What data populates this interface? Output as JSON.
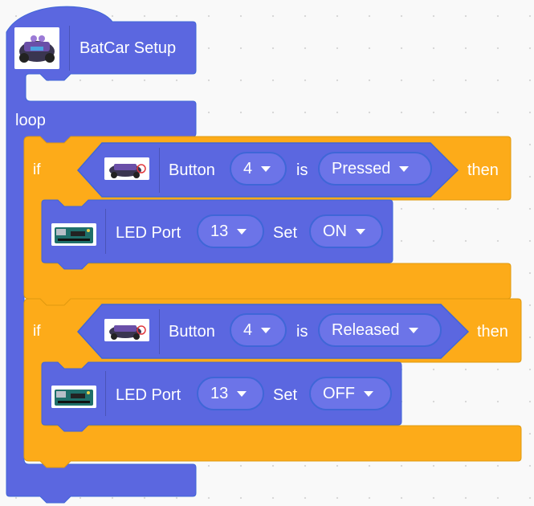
{
  "setup_block": {
    "label": "BatCar Setup",
    "icon": "batcar-robot-icon"
  },
  "loop_block": {
    "label": "loop"
  },
  "if_blocks": [
    {
      "if_label": "if",
      "then_label": "then",
      "condition": {
        "icon": "batcar-robot-icon",
        "button_label": "Button",
        "button_port": "4",
        "is_label": "is",
        "state": "Pressed"
      },
      "action": {
        "icon": "arduino-board-icon",
        "led_label": "LED Port",
        "port": "13",
        "set_label": "Set",
        "value": "ON"
      }
    },
    {
      "if_label": "if",
      "then_label": "then",
      "condition": {
        "icon": "batcar-robot-icon",
        "button_label": "Button",
        "button_port": "4",
        "is_label": "is",
        "state": "Released"
      },
      "action": {
        "icon": "arduino-board-icon",
        "led_label": "LED Port",
        "port": "13",
        "set_label": "Set",
        "value": "OFF"
      }
    }
  ],
  "colors": {
    "motion_blue": "#5b67e0",
    "control_orange": "#fdab19",
    "input_field": "#6c74e8",
    "outline": "#3f66d7"
  }
}
